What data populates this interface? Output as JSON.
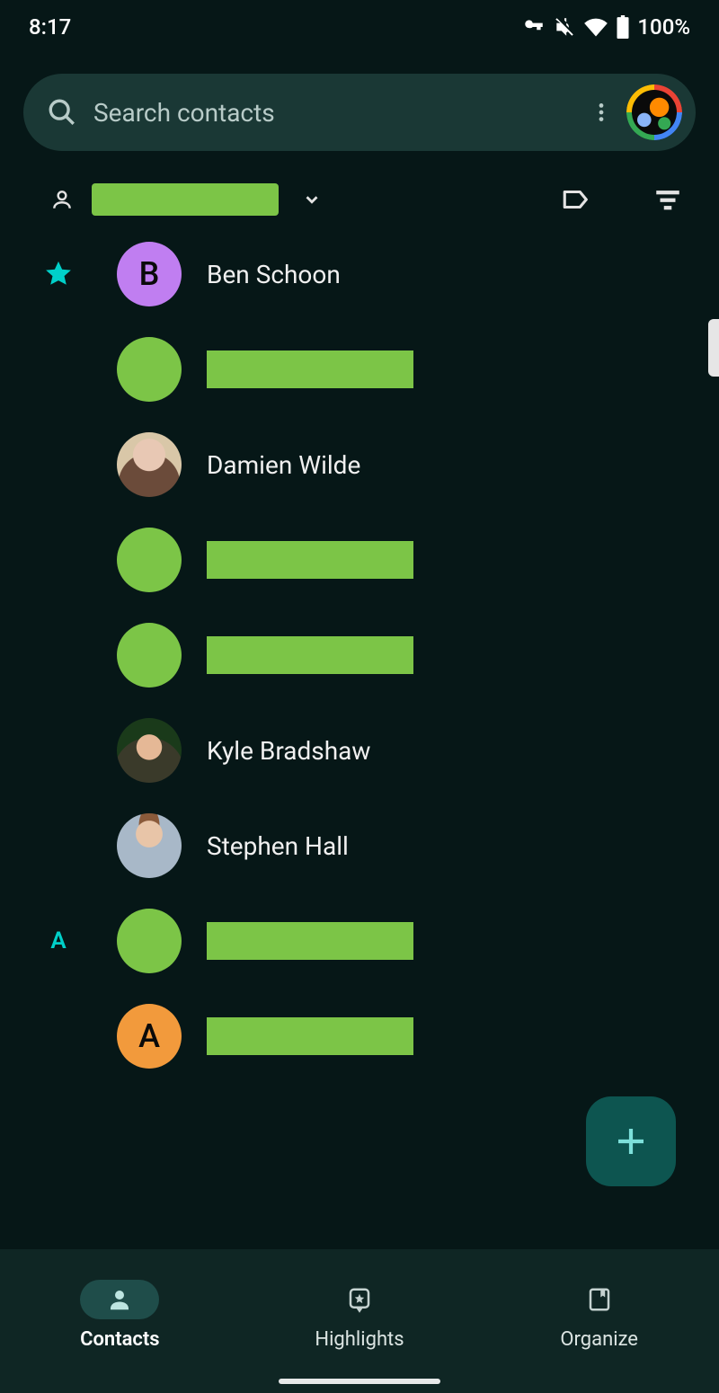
{
  "status": {
    "time": "8:17",
    "battery_pct": "100%"
  },
  "search": {
    "placeholder": "Search contacts"
  },
  "sections": [
    {
      "key": "star",
      "kind": "star"
    },
    {
      "key": "A",
      "kind": "letter",
      "label": "A"
    }
  ],
  "contacts": [
    {
      "section": "star",
      "name": "Ben Schoon",
      "avatar": "letter",
      "initial": "B",
      "color": "B",
      "redacted": false
    },
    {
      "section": "star",
      "name": "",
      "avatar": "redacted",
      "redacted": true
    },
    {
      "section": "star",
      "name": "Damien Wilde",
      "avatar": "photo",
      "photo_class": "av-photo-damien",
      "redacted": false
    },
    {
      "section": "star",
      "name": "",
      "avatar": "redacted",
      "redacted": true
    },
    {
      "section": "star",
      "name": "",
      "avatar": "redacted",
      "redacted": true
    },
    {
      "section": "star",
      "name": "Kyle Bradshaw",
      "avatar": "photo",
      "photo_class": "av-photo-kyle",
      "redacted": false
    },
    {
      "section": "star",
      "name": "Stephen Hall",
      "avatar": "photo",
      "photo_class": "av-photo-stephen",
      "redacted": false
    },
    {
      "section": "A",
      "name": "",
      "avatar": "redacted",
      "redacted": true
    },
    {
      "section": "A",
      "name": "",
      "avatar": "letter",
      "initial": "A",
      "color": "A",
      "redacted": true
    }
  ],
  "nav": {
    "contacts": "Contacts",
    "highlights": "Highlights",
    "organize": "Organize"
  }
}
